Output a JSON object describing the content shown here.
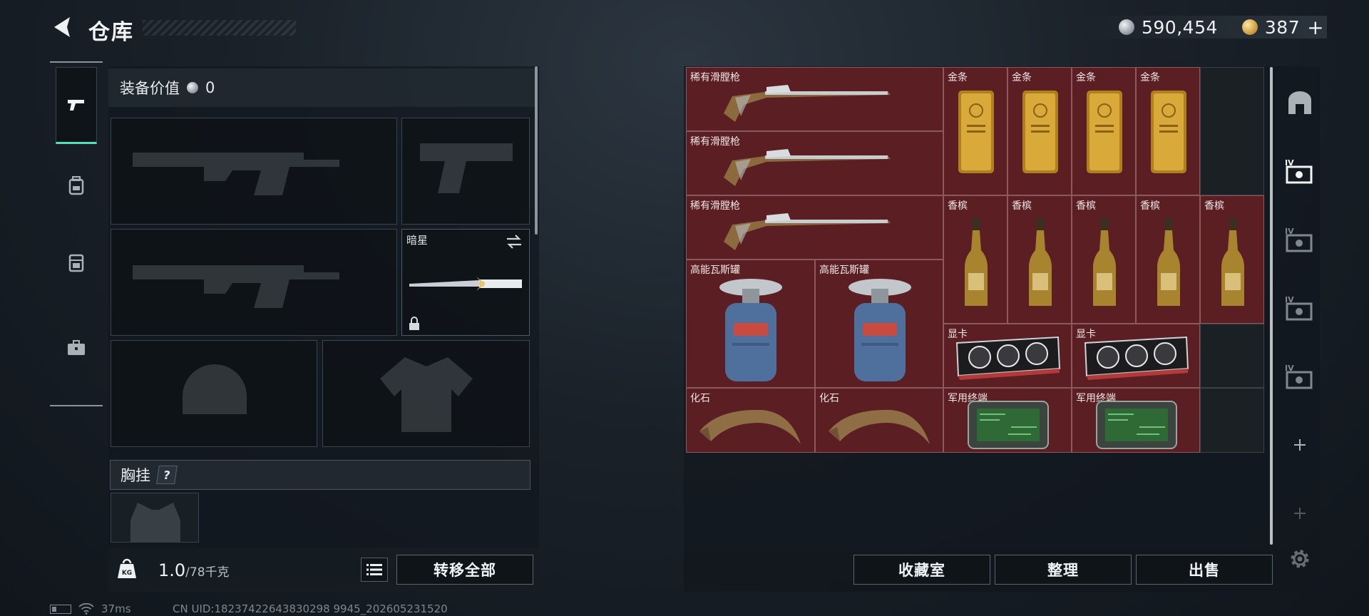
{
  "header": {
    "title": "仓库",
    "currency_silver": "590,454",
    "currency_gold": "387",
    "gold_add": "+"
  },
  "left_tabs": [
    {
      "name": "weapons",
      "icon": "pistol-icon",
      "active": true
    },
    {
      "name": "backpack",
      "icon": "backpack-icon",
      "active": false
    },
    {
      "name": "chest-rig",
      "icon": "vest-icon",
      "active": false
    },
    {
      "name": "toolbox",
      "icon": "briefcase-icon",
      "active": false
    }
  ],
  "equipment": {
    "value_label": "装备价值",
    "value": "0",
    "melee_name": "暗星",
    "chest_label": "胸挂",
    "chest_help": "?",
    "weight": "1.0",
    "weight_max": "/78千克",
    "transfer_all": "转移全部"
  },
  "inventory": {
    "items": [
      {
        "name": "稀有滑膛枪",
        "kind": "musket"
      },
      {
        "name": "稀有滑膛枪",
        "kind": "musket"
      },
      {
        "name": "稀有滑膛枪",
        "kind": "musket"
      },
      {
        "name": "金条",
        "kind": "gold-bar"
      },
      {
        "name": "金条",
        "kind": "gold-bar"
      },
      {
        "name": "金条",
        "kind": "gold-bar"
      },
      {
        "name": "金条",
        "kind": "gold-bar"
      },
      {
        "name": "香槟",
        "kind": "champagne"
      },
      {
        "name": "香槟",
        "kind": "champagne"
      },
      {
        "name": "香槟",
        "kind": "champagne"
      },
      {
        "name": "香槟",
        "kind": "champagne"
      },
      {
        "name": "香槟",
        "kind": "champagne"
      },
      {
        "name": "高能瓦斯罐",
        "kind": "gas-canister"
      },
      {
        "name": "高能瓦斯罐",
        "kind": "gas-canister"
      },
      {
        "name": "显卡",
        "kind": "graphics-card"
      },
      {
        "name": "显卡",
        "kind": "graphics-card"
      },
      {
        "name": "化石",
        "kind": "fossil-claw"
      },
      {
        "name": "化石",
        "kind": "fossil-claw"
      },
      {
        "name": "军用终端",
        "kind": "military-terminal"
      },
      {
        "name": "军用终端",
        "kind": "military-terminal"
      }
    ]
  },
  "side_icons": [
    "stash-icon",
    "case-iv-icon",
    "case-iv-icon",
    "case-iv-icon",
    "case-iv-icon",
    "plus-icon",
    "plus-icon"
  ],
  "footer": {
    "collection": "收藏室",
    "organize": "整理",
    "sell": "出售"
  },
  "status": {
    "ping": "37ms",
    "uid": "CN UID:18237422643830298 9945_202605231520"
  },
  "colors": {
    "item_bg": "#5a1e23",
    "accent": "#4ee2b6"
  }
}
